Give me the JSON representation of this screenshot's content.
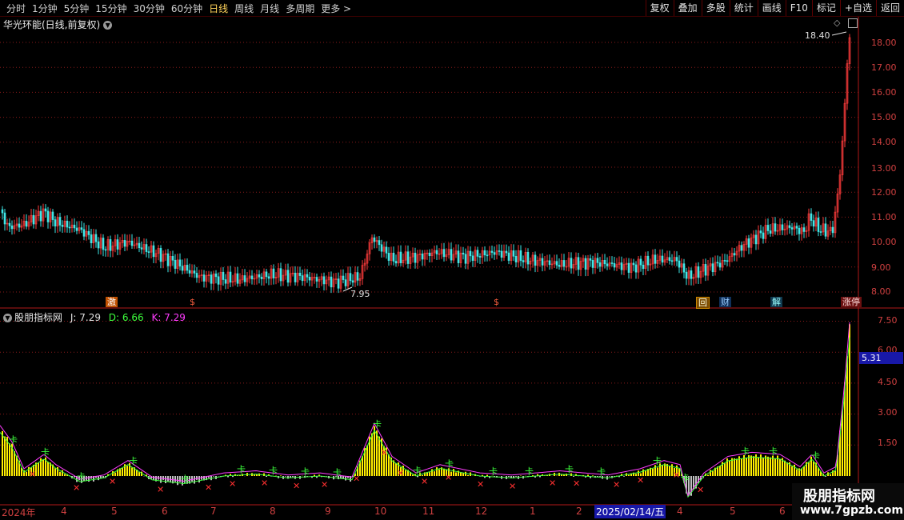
{
  "topbar": {
    "tabs": [
      "分时",
      "1分钟",
      "5分钟",
      "15分钟",
      "30分钟",
      "60分钟",
      "日线",
      "周线",
      "月线",
      "多周期",
      "更多 >"
    ],
    "active_tab": "日线",
    "tools": [
      "复权",
      "叠加",
      "多股",
      "统计",
      "画线",
      "F10",
      "标记",
      "+自选",
      "返回"
    ]
  },
  "main_chart": {
    "title": "华光环能(日线,前复权)",
    "high_label": "18.40",
    "low_label": "7.95",
    "price_ticks": [
      "18.00",
      "17.00",
      "16.00",
      "15.00",
      "14.00",
      "13.00",
      "12.00",
      "11.00",
      "10.00",
      "9.00",
      "8.00"
    ],
    "event_tags": [
      "激",
      "$",
      "$",
      "回",
      "财",
      "解",
      "涨停"
    ]
  },
  "indicator": {
    "name": "股朋指标网",
    "j_label": "J: 7.29",
    "d_label": "D: 6.66",
    "k_label": "K: 7.29",
    "ticks": [
      "7.50",
      "6.00",
      "4.50",
      "3.00",
      "1.50"
    ],
    "current_value": "5.31"
  },
  "x_axis": {
    "labels": [
      "2024年",
      "4",
      "5",
      "6",
      "7",
      "8",
      "9",
      "10",
      "11",
      "12",
      "1",
      "2",
      "2025/02/14/五",
      "4",
      "5",
      "6"
    ],
    "selected_date": "2025/02/14/五"
  },
  "watermark": {
    "title": "股朋指标网",
    "url": "www.7gpzb.com"
  },
  "colors": {
    "up": "#ff3b3b",
    "down": "#3ee8e8",
    "grid": "#8a1a1a",
    "j": "#ff3cff",
    "d": "#3cff3c",
    "k": "#ff3cff",
    "bar_yellow": "#ffee00"
  }
}
